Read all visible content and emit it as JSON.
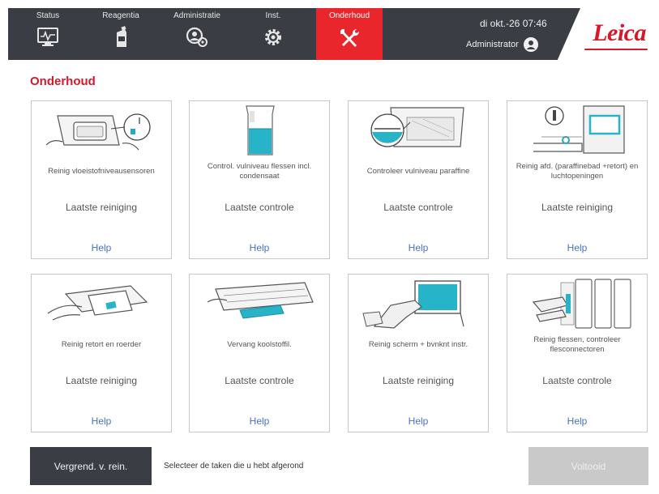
{
  "header": {
    "tabs": [
      {
        "label": "Status",
        "icon": "monitor-pulse-icon"
      },
      {
        "label": "Reagentia",
        "icon": "reagent-bottle-icon"
      },
      {
        "label": "Administratie",
        "icon": "admin-cog-user-icon"
      },
      {
        "label": "Inst.",
        "icon": "gear-icon"
      },
      {
        "label": "Onderhoud",
        "icon": "tools-icon",
        "active": true
      }
    ],
    "datetime": "di okt.-26 07:46",
    "user": "Administrator",
    "logo": "Leica",
    "colors": {
      "bar": "#3a3d44",
      "active": "#e8262b",
      "brand": "#d7182a"
    }
  },
  "page_title": "Onderhoud",
  "cards": [
    {
      "label": "Reinig vloeistofniveausensoren",
      "status": "Laatste reiniging",
      "help": "Help",
      "icon": "level-sensor-illustration"
    },
    {
      "label": "Control. vulniveau flessen incl. condensaat",
      "status": "Laatste controle",
      "help": "Help",
      "icon": "bottle-level-illustration"
    },
    {
      "label": "Controleer vulniveau paraffine",
      "status": "Laatste controle",
      "help": "Help",
      "icon": "paraffin-level-illustration"
    },
    {
      "label": "Reinig afd. (paraffinebad +retort) en luchtopeningen",
      "status": "Laatste reiniging",
      "help": "Help",
      "icon": "seal-vent-illustration"
    },
    {
      "label": "Reinig retort en roerder",
      "status": "Laatste reiniging",
      "help": "Help",
      "icon": "retort-stirrer-illustration"
    },
    {
      "label": "Vervang koolstoffil.",
      "status": "Laatste controle",
      "help": "Help",
      "icon": "carbon-filter-illustration"
    },
    {
      "label": "Reinig scherm + bvnknt instr.",
      "status": "Laatste reiniging",
      "help": "Help",
      "icon": "touchscreen-clean-illustration"
    },
    {
      "label": "Reinig flessen, controleer flesconnectoren",
      "status": "Laatste controle",
      "help": "Help",
      "icon": "bottle-connector-illustration"
    }
  ],
  "footer": {
    "lock_button": "Vergrend. v. rein.",
    "hint": "Selecteer de taken die u hebt afgerond",
    "done_button": "Voltooid"
  }
}
